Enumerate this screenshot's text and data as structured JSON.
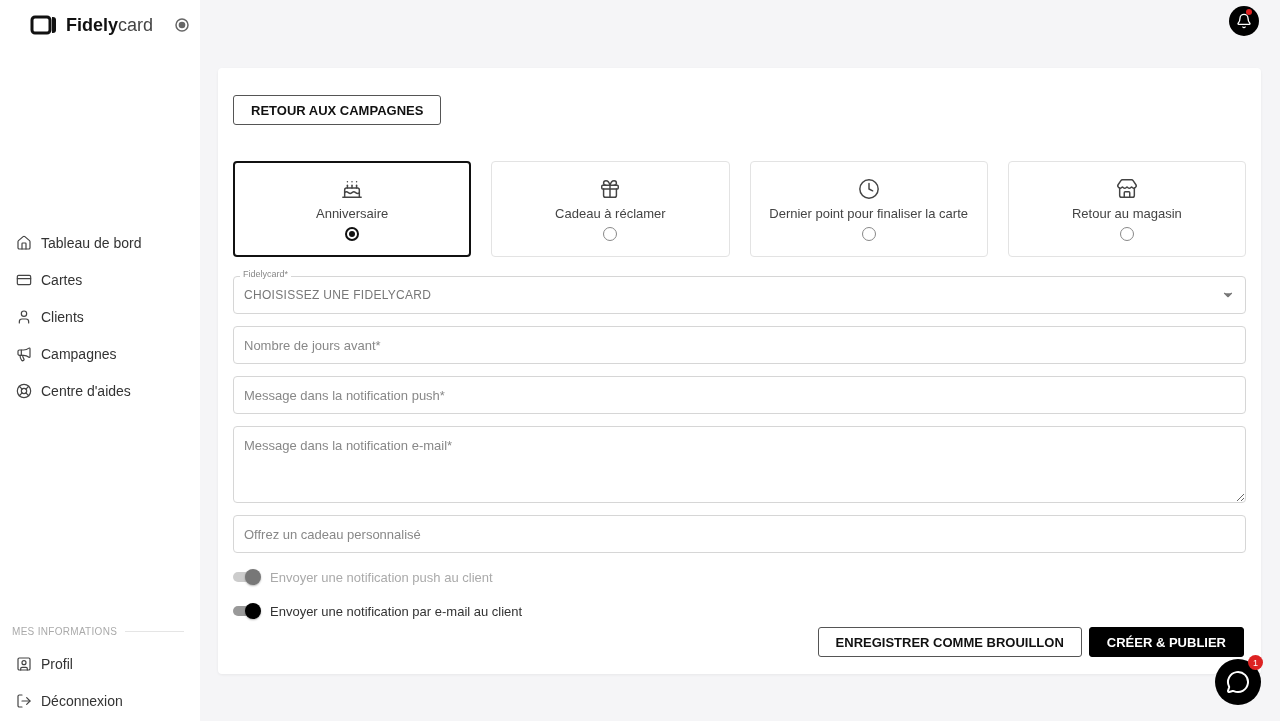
{
  "brand": {
    "logo": "**Fidely**card"
  },
  "sidebar": {
    "items": [
      {
        "label": "Tableau de bord"
      },
      {
        "label": "Cartes"
      },
      {
        "label": "Clients"
      },
      {
        "label": "Campagnes"
      },
      {
        "label": "Centre d'aides"
      }
    ],
    "section_title": "MES INFORMATIONS",
    "footer_items": [
      {
        "label": "Profil"
      },
      {
        "label": "Déconnexion"
      }
    ]
  },
  "notifications": {
    "unread": true
  },
  "back_button": "RETOUR AUX CAMPAGNES",
  "campaign_types": [
    {
      "label": "Anniversaire",
      "selected": true
    },
    {
      "label": "Cadeau à réclamer",
      "selected": false
    },
    {
      "label": "Dernier point pour finaliser la carte",
      "selected": false
    },
    {
      "label": "Retour au magasin",
      "selected": false
    }
  ],
  "select": {
    "label": "Fidelycard*",
    "value": "CHOISISSEZ UNE FIDELYCARD"
  },
  "fields": [
    {
      "kind": "input",
      "placeholder": "Nombre de jours avant*"
    },
    {
      "kind": "input",
      "placeholder": "Message dans la notification push*"
    },
    {
      "kind": "textarea",
      "placeholder": "Message dans la notification e-mail*"
    },
    {
      "kind": "input",
      "placeholder": "Offrez un cadeau personnalisé"
    }
  ],
  "toggles": [
    {
      "label": "Envoyer une notification push au client",
      "on": true,
      "disabled": true
    },
    {
      "label": "Envoyer une notification par e-mail au client",
      "on": true,
      "disabled": false
    }
  ],
  "actions": [
    {
      "label": "ENREGISTRER COMME BROUILLON",
      "kind": "outline"
    },
    {
      "label": "CRÉER & PUBLIER",
      "kind": "primary"
    }
  ],
  "chat": {
    "badge": "1"
  }
}
